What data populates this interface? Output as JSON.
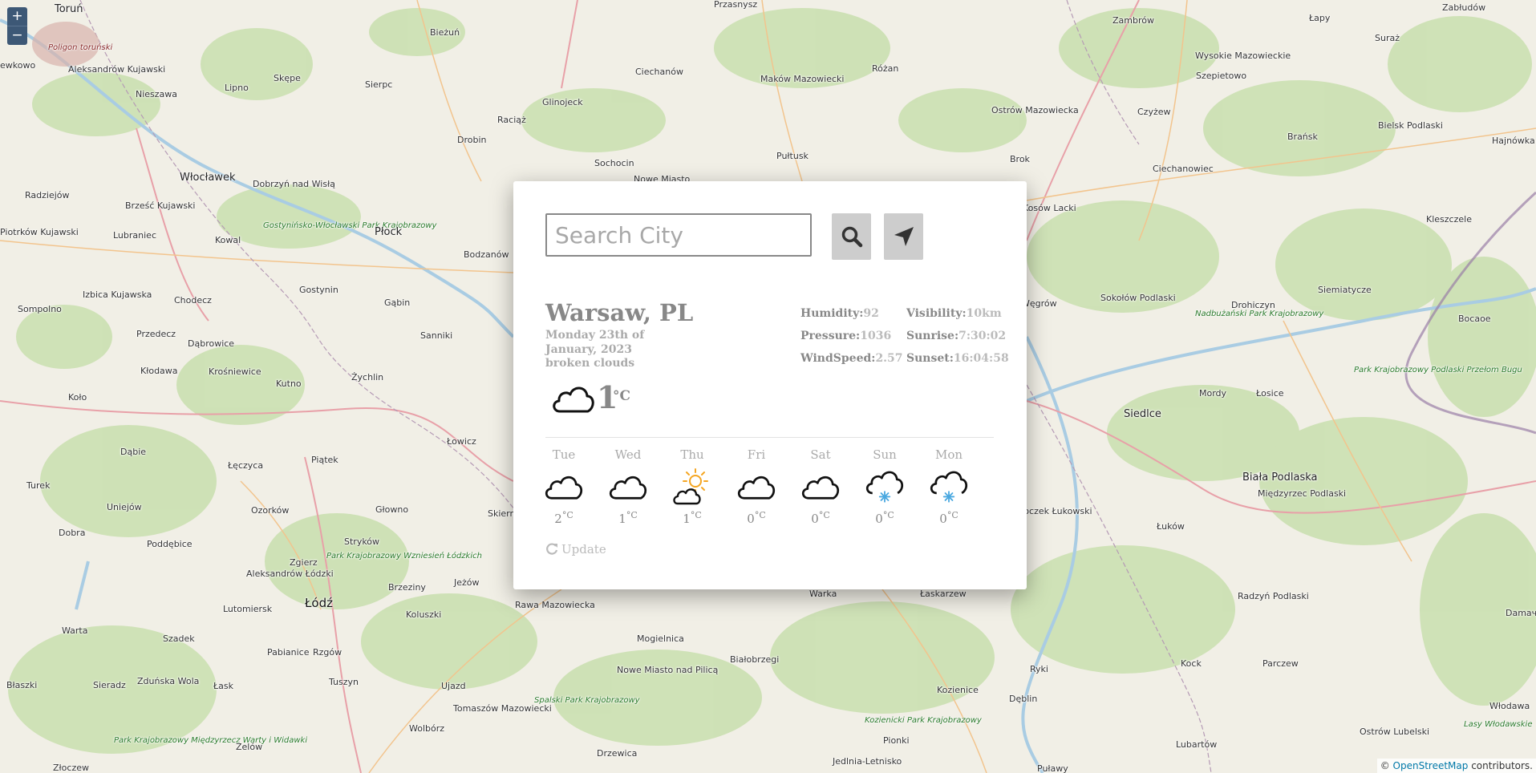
{
  "map": {
    "zoom_in": "+",
    "zoom_out": "−",
    "attribution_prefix": "©",
    "attribution_link": "OpenStreetMap",
    "attribution_suffix": "contributors.",
    "places": [
      {
        "name": "Toruń",
        "kind": "city"
      },
      {
        "name": "Poligon toruński",
        "kind": "military"
      },
      {
        "name": "ewkowo",
        "kind": "town"
      },
      {
        "name": "Aleksandrów Kujawski",
        "kind": "town"
      },
      {
        "name": "Nieszawa",
        "kind": "town"
      },
      {
        "name": "Lipno",
        "kind": "town"
      },
      {
        "name": "Skępe",
        "kind": "town"
      },
      {
        "name": "Bieżuń",
        "kind": "town"
      },
      {
        "name": "Sierpc",
        "kind": "town"
      },
      {
        "name": "Przasnysz",
        "kind": "town"
      },
      {
        "name": "Ciechanów",
        "kind": "town"
      },
      {
        "name": "Glinojeck",
        "kind": "town"
      },
      {
        "name": "Raciąż",
        "kind": "town"
      },
      {
        "name": "Drobin",
        "kind": "town"
      },
      {
        "name": "Sochocin",
        "kind": "town"
      },
      {
        "name": "Maków Mazowiecki",
        "kind": "town"
      },
      {
        "name": "Różan",
        "kind": "town"
      },
      {
        "name": "Pułtusk",
        "kind": "town"
      },
      {
        "name": "Ostrów Mazowiecka",
        "kind": "town"
      },
      {
        "name": "Zambrów",
        "kind": "town"
      },
      {
        "name": "Wysokie Mazowieckie",
        "kind": "town"
      },
      {
        "name": "Szepietowo",
        "kind": "town"
      },
      {
        "name": "Czyżew",
        "kind": "town"
      },
      {
        "name": "Łapy",
        "kind": "town"
      },
      {
        "name": "Suraż",
        "kind": "town"
      },
      {
        "name": "Zabłudów",
        "kind": "town"
      },
      {
        "name": "Bielsk Podlaski",
        "kind": "town"
      },
      {
        "name": "Brańsk",
        "kind": "town"
      },
      {
        "name": "Hajnówka",
        "kind": "town"
      },
      {
        "name": "Ciechanowiec",
        "kind": "town"
      },
      {
        "name": "Brok",
        "kind": "town"
      },
      {
        "name": "Radziejów",
        "kind": "town"
      },
      {
        "name": "Włocławek",
        "kind": "city"
      },
      {
        "name": "Brześć Kujawski",
        "kind": "town"
      },
      {
        "name": "Dobrzyń nad Wisłą",
        "kind": "town"
      },
      {
        "name": "Lubraniec",
        "kind": "town"
      },
      {
        "name": "Kowal",
        "kind": "town"
      },
      {
        "name": "Gostynińsko-Włocławski Park Krajobrazowy",
        "kind": "park"
      },
      {
        "name": "Płock",
        "kind": "city"
      },
      {
        "name": "Bodzanów",
        "kind": "town"
      },
      {
        "name": "Piotrków Kujawski",
        "kind": "town"
      },
      {
        "name": "Izbica Kujawska",
        "kind": "town"
      },
      {
        "name": "Chodecz",
        "kind": "town"
      },
      {
        "name": "Gostynin",
        "kind": "town"
      },
      {
        "name": "Gąbin",
        "kind": "town"
      },
      {
        "name": "Sompolno",
        "kind": "town"
      },
      {
        "name": "Przedecz",
        "kind": "town"
      },
      {
        "name": "Dąbrowice",
        "kind": "town"
      },
      {
        "name": "Sanniki",
        "kind": "town"
      },
      {
        "name": "Kłodawa",
        "kind": "town"
      },
      {
        "name": "Krośniewice",
        "kind": "town"
      },
      {
        "name": "Żychlin",
        "kind": "town"
      },
      {
        "name": "Koło",
        "kind": "town"
      },
      {
        "name": "Kutno",
        "kind": "town"
      },
      {
        "name": "Łowicz",
        "kind": "town"
      },
      {
        "name": "Dąbie",
        "kind": "town"
      },
      {
        "name": "Piątek",
        "kind": "town"
      },
      {
        "name": "Łęczyca",
        "kind": "town"
      },
      {
        "name": "Turek",
        "kind": "town"
      },
      {
        "name": "Uniejów",
        "kind": "town"
      },
      {
        "name": "Ozorków",
        "kind": "town"
      },
      {
        "name": "Głowno",
        "kind": "town"
      },
      {
        "name": "Skierniewice",
        "kind": "town"
      },
      {
        "name": "Dobra",
        "kind": "town"
      },
      {
        "name": "Poddębice",
        "kind": "town"
      },
      {
        "name": "Stryków",
        "kind": "town"
      },
      {
        "name": "Zgierz",
        "kind": "town"
      },
      {
        "name": "Park Krajobrazowy Wzniesień Łódzkich",
        "kind": "park"
      },
      {
        "name": "Aleksandrów Łódzki",
        "kind": "town"
      },
      {
        "name": "Brzeziny",
        "kind": "town"
      },
      {
        "name": "Jeżów",
        "kind": "town"
      },
      {
        "name": "Łódź",
        "kind": "big"
      },
      {
        "name": "Koluszki",
        "kind": "town"
      },
      {
        "name": "Lutomiersk",
        "kind": "town"
      },
      {
        "name": "Warta",
        "kind": "town"
      },
      {
        "name": "Szadek",
        "kind": "town"
      },
      {
        "name": "Pabianice",
        "kind": "town"
      },
      {
        "name": "Rzgów",
        "kind": "town"
      },
      {
        "name": "Zduńska Wola",
        "kind": "town"
      },
      {
        "name": "Łask",
        "kind": "town"
      },
      {
        "name": "Sieradz",
        "kind": "town"
      },
      {
        "name": "Tuszyn",
        "kind": "town"
      },
      {
        "name": "Błaszki",
        "kind": "town"
      },
      {
        "name": "Ujazd",
        "kind": "town"
      },
      {
        "name": "Tomaszów Mazowiecki",
        "kind": "town"
      },
      {
        "name": "Wolbórz",
        "kind": "town"
      },
      {
        "name": "Park Krajobrazowy Międzyrzecz Warty i Widawki",
        "kind": "park"
      },
      {
        "name": "Zelów",
        "kind": "town"
      },
      {
        "name": "Złoczew",
        "kind": "town"
      },
      {
        "name": "Rawa Mazowiecka",
        "kind": "town"
      },
      {
        "name": "Mogielnica",
        "kind": "town"
      },
      {
        "name": "Nowe Miasto nad Pilicą",
        "kind": "town"
      },
      {
        "name": "Spalski Park Krajobrazowy",
        "kind": "park"
      },
      {
        "name": "Białobrzegi",
        "kind": "town"
      },
      {
        "name": "Drzewica",
        "kind": "town"
      },
      {
        "name": "Warka",
        "kind": "town"
      },
      {
        "name": "Łaskarzew",
        "kind": "town"
      },
      {
        "name": "Kozienice",
        "kind": "town"
      },
      {
        "name": "Kozienicki Park Krajobrazowy",
        "kind": "park"
      },
      {
        "name": "Pionki",
        "kind": "town"
      },
      {
        "name": "Jedlnia-Letnisko",
        "kind": "town"
      },
      {
        "name": "Dęblin",
        "kind": "town"
      },
      {
        "name": "Ryki",
        "kind": "town"
      },
      {
        "name": "Puławy",
        "kind": "town"
      },
      {
        "name": "Kosów Lacki",
        "kind": "town"
      },
      {
        "name": "Sokołów Podlaski",
        "kind": "town"
      },
      {
        "name": "Węgrów",
        "kind": "town"
      },
      {
        "name": "Siemiatycze",
        "kind": "town"
      },
      {
        "name": "Drohiczyn",
        "kind": "town"
      },
      {
        "name": "Nadbużański Park Krajobrazowy",
        "kind": "park"
      },
      {
        "name": "Kleszczele",
        "kind": "town"
      },
      {
        "name": "Bocaoe",
        "kind": "town"
      },
      {
        "name": "Park Krajobrazowy Podlaski Przełom Bugu",
        "kind": "park"
      },
      {
        "name": "Mordy",
        "kind": "town"
      },
      {
        "name": "Łosice",
        "kind": "town"
      },
      {
        "name": "Siedlce",
        "kind": "city"
      },
      {
        "name": "Biała Podlaska",
        "kind": "city"
      },
      {
        "name": "Międzyrzec Podlaski",
        "kind": "town"
      },
      {
        "name": "Łuków",
        "kind": "town"
      },
      {
        "name": "Stoczek Łukowski",
        "kind": "town"
      },
      {
        "name": "Radzyń Podlaski",
        "kind": "town"
      },
      {
        "name": "Parczew",
        "kind": "town"
      },
      {
        "name": "Kock",
        "kind": "town"
      },
      {
        "name": "Lubartów",
        "kind": "town"
      },
      {
        "name": "Ostrów Lubelski",
        "kind": "town"
      },
      {
        "name": "Włodawa",
        "kind": "town"
      },
      {
        "name": "Lasy Włodawskie",
        "kind": "park"
      },
      {
        "name": "Damaчeвa",
        "kind": "town"
      },
      {
        "name": "Nowe Miasto",
        "kind": "town"
      }
    ]
  },
  "search": {
    "placeholder": "Search City"
  },
  "weather": {
    "city": "Warsaw, PL",
    "date": "Monday 23th of January, 2023",
    "description": "broken clouds",
    "icon": "cloud-icon",
    "temp": "1",
    "unit": "°C",
    "stats": {
      "humidity_label": "Humidity:",
      "humidity": "92",
      "visibility_label": "Visibility:",
      "visibility": "10km",
      "pressure_label": "Pressure:",
      "pressure": "1036",
      "sunrise_label": "Sunrise:",
      "sunrise": "7:30:02",
      "wind_label": "WindSpeed:",
      "wind": "2.57",
      "sunset_label": "Sunset:",
      "sunset": "16:04:58"
    },
    "forecast": [
      {
        "day": "Tue",
        "icon": "cloud-icon",
        "temp": "2"
      },
      {
        "day": "Wed",
        "icon": "cloud-icon",
        "temp": "1"
      },
      {
        "day": "Thu",
        "icon": "partly-sunny-icon",
        "temp": "1"
      },
      {
        "day": "Fri",
        "icon": "cloud-icon",
        "temp": "0"
      },
      {
        "day": "Sat",
        "icon": "cloud-icon",
        "temp": "0"
      },
      {
        "day": "Sun",
        "icon": "snow-cloud-icon",
        "temp": "0"
      },
      {
        "day": "Mon",
        "icon": "snow-cloud-icon",
        "temp": "0"
      }
    ],
    "forecast_unit": "°C",
    "update_label": "Update"
  },
  "colors": {
    "sun": "#f5a623",
    "snow": "#4aa8e0",
    "zoom_bg": "#3d5876"
  }
}
